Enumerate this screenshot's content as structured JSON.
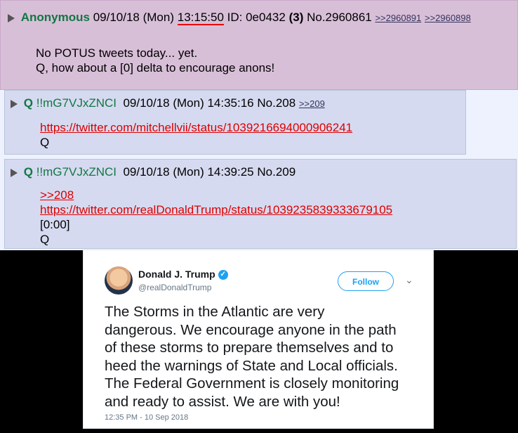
{
  "posts": [
    {
      "name": "Anonymous",
      "date": "09/10/18 (Mon)",
      "time": "13:15:50",
      "id_label": "ID: 0e0432",
      "id_count": "(3)",
      "number": "No.2960861",
      "replies": [
        ">>2960891",
        ">>2960898"
      ],
      "lines": [
        "No POTUS tweets today... yet.",
        "Q, how about a [0] delta to encourage anons!"
      ]
    },
    {
      "name": "Q",
      "tripcode": "!!mG7VJxZNCI",
      "datetime": "09/10/18 (Mon) 14:35:16",
      "number": "No.208",
      "replies": [
        ">>209"
      ],
      "link": "https://twitter.com/mitchellvii/status/1039216694000906241",
      "lines": [
        "Q"
      ]
    },
    {
      "name": "Q",
      "tripcode": "!!mG7VJxZNCI",
      "datetime": "09/10/18 (Mon) 14:39:25",
      "number": "No.209",
      "quote": ">>208",
      "link": "https://twitter.com/realDonaldTrump/status/1039235839333679105",
      "lines": [
        "[0:00]",
        "Q"
      ]
    }
  ],
  "tweet": {
    "display_name": "Donald J. Trump",
    "handle": "@realDonaldTrump",
    "follow_label": "Follow",
    "text_lines": [
      "The Storms in the Atlantic are very",
      "dangerous. We encourage anyone in the path",
      "of these storms to prepare themselves and to",
      "heed the warnings of State and Local officials.",
      "The Federal Government is closely monitoring",
      "and ready to assist. We are with you!"
    ],
    "timestamp": "12:35 PM - 10 Sep 2018",
    "accent": "#1da1f2"
  }
}
